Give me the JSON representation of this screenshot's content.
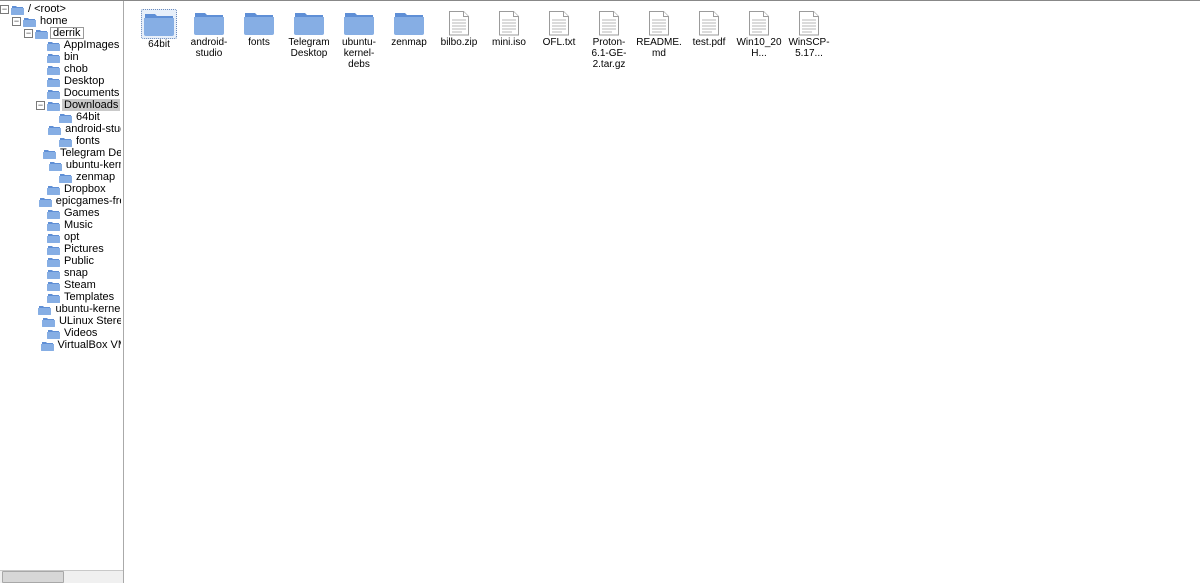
{
  "tree": [
    {
      "depth": 0,
      "label": "/ <root>",
      "expander": "−",
      "kind": "folder"
    },
    {
      "depth": 1,
      "label": "home",
      "expander": "−",
      "kind": "folder"
    },
    {
      "depth": 2,
      "label": "derrik",
      "expander": "−",
      "kind": "folder",
      "box": true
    },
    {
      "depth": 3,
      "label": "AppImages",
      "expander": "",
      "kind": "folder"
    },
    {
      "depth": 3,
      "label": "bin",
      "expander": "",
      "kind": "folder"
    },
    {
      "depth": 3,
      "label": "chob",
      "expander": "",
      "kind": "folder"
    },
    {
      "depth": 3,
      "label": "Desktop",
      "expander": "",
      "kind": "folder"
    },
    {
      "depth": 3,
      "label": "Documents",
      "expander": "",
      "kind": "folder"
    },
    {
      "depth": 3,
      "label": "Downloads",
      "expander": "−",
      "kind": "folder",
      "selected": true
    },
    {
      "depth": 4,
      "label": "64bit",
      "expander": "",
      "kind": "folder"
    },
    {
      "depth": 4,
      "label": "android-studio",
      "expander": "",
      "kind": "folder"
    },
    {
      "depth": 4,
      "label": "fonts",
      "expander": "",
      "kind": "folder"
    },
    {
      "depth": 4,
      "label": "Telegram Desktop",
      "expander": "",
      "kind": "folder"
    },
    {
      "depth": 4,
      "label": "ubuntu-kernel",
      "expander": "",
      "kind": "folder"
    },
    {
      "depth": 4,
      "label": "zenmap",
      "expander": "",
      "kind": "folder"
    },
    {
      "depth": 3,
      "label": "Dropbox",
      "expander": "",
      "kind": "folder"
    },
    {
      "depth": 3,
      "label": "epicgames-freeb",
      "expander": "",
      "kind": "folder"
    },
    {
      "depth": 3,
      "label": "Games",
      "expander": "",
      "kind": "folder"
    },
    {
      "depth": 3,
      "label": "Music",
      "expander": "",
      "kind": "folder"
    },
    {
      "depth": 3,
      "label": "opt",
      "expander": "",
      "kind": "folder"
    },
    {
      "depth": 3,
      "label": "Pictures",
      "expander": "",
      "kind": "folder"
    },
    {
      "depth": 3,
      "label": "Public",
      "expander": "",
      "kind": "folder"
    },
    {
      "depth": 3,
      "label": "snap",
      "expander": "",
      "kind": "folder"
    },
    {
      "depth": 3,
      "label": "Steam",
      "expander": "",
      "kind": "folder"
    },
    {
      "depth": 3,
      "label": "Templates",
      "expander": "",
      "kind": "folder"
    },
    {
      "depth": 3,
      "label": "ubuntu-kernel-de",
      "expander": "",
      "kind": "folder"
    },
    {
      "depth": 3,
      "label": "ULinux Stereo",
      "expander": "",
      "kind": "folder"
    },
    {
      "depth": 3,
      "label": "Videos",
      "expander": "",
      "kind": "folder"
    },
    {
      "depth": 3,
      "label": "VirtualBox VMs",
      "expander": "",
      "kind": "folder"
    }
  ],
  "items": [
    {
      "label": "64bit",
      "kind": "folder",
      "selected": true
    },
    {
      "label": "android-studio",
      "kind": "folder"
    },
    {
      "label": "fonts",
      "kind": "folder"
    },
    {
      "label": "Telegram Desktop",
      "kind": "folder"
    },
    {
      "label": "ubuntu-kernel-debs",
      "kind": "folder"
    },
    {
      "label": "zenmap",
      "kind": "folder"
    },
    {
      "label": "bilbo.zip",
      "kind": "file"
    },
    {
      "label": "mini.iso",
      "kind": "file"
    },
    {
      "label": "OFL.txt",
      "kind": "file"
    },
    {
      "label": "Proton-6.1-GE-2.tar.gz",
      "kind": "file"
    },
    {
      "label": "README.md",
      "kind": "file"
    },
    {
      "label": "test.pdf",
      "kind": "file"
    },
    {
      "label": "Win10_20H...",
      "kind": "file"
    },
    {
      "label": "WinSCP-5.17...",
      "kind": "file"
    }
  ]
}
